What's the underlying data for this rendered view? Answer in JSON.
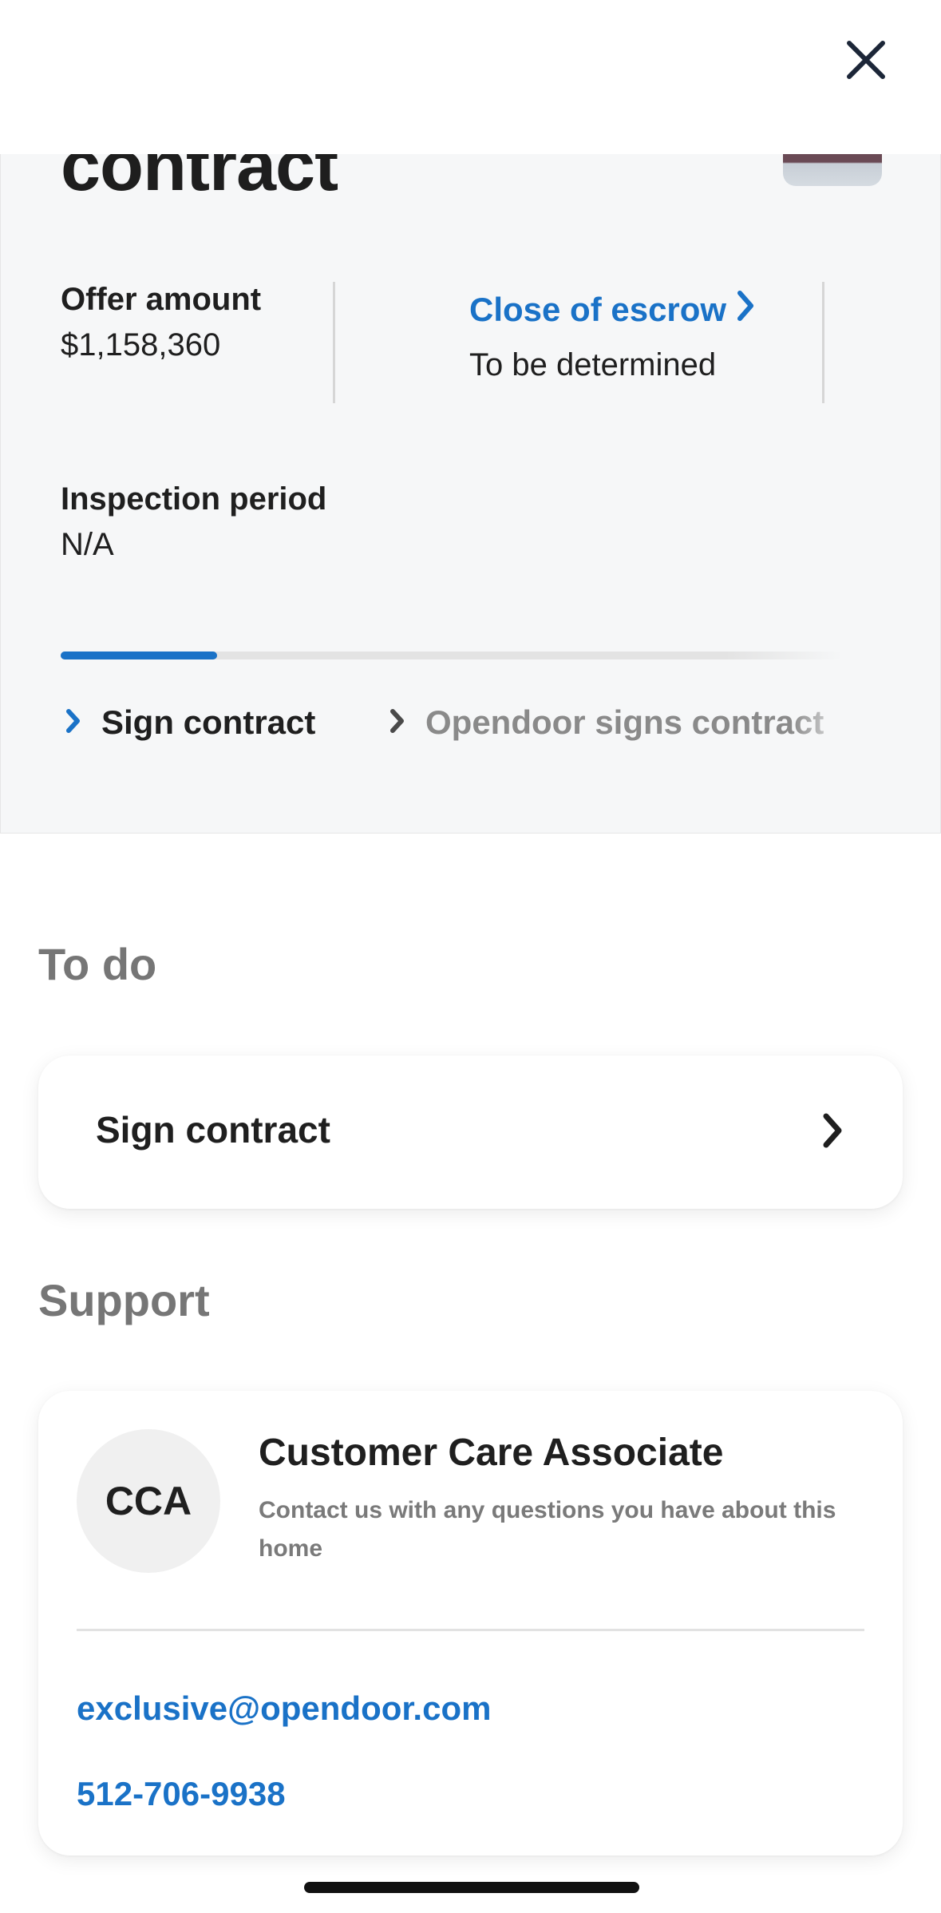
{
  "header": {
    "title": "contract",
    "close_icon": "close-icon"
  },
  "offer": {
    "label": "Offer amount",
    "value": "$1,158,360"
  },
  "escrow": {
    "label": "Close of escrow",
    "value": "To be determined"
  },
  "inspection": {
    "label": "Inspection period",
    "value": "N/A"
  },
  "progress": {
    "fraction": 0.2
  },
  "steps": [
    {
      "label": "Sign contract",
      "state": "active"
    },
    {
      "label": "Opendoor signs contract",
      "state": "upcoming"
    }
  ],
  "todo": {
    "heading": "To do",
    "items": [
      {
        "label": "Sign contract"
      }
    ]
  },
  "support": {
    "heading": "Support",
    "avatar_initials": "CCA",
    "name": "Customer Care Associate",
    "description": "Contact us with any questions you have about this home",
    "email": "exclusive@opendoor.com",
    "phone": "512-706-9938"
  },
  "colors": {
    "accent": "#1a72c7",
    "panel_bg": "#f6f7f8",
    "text": "#1f1f1f",
    "muted": "#767676"
  }
}
